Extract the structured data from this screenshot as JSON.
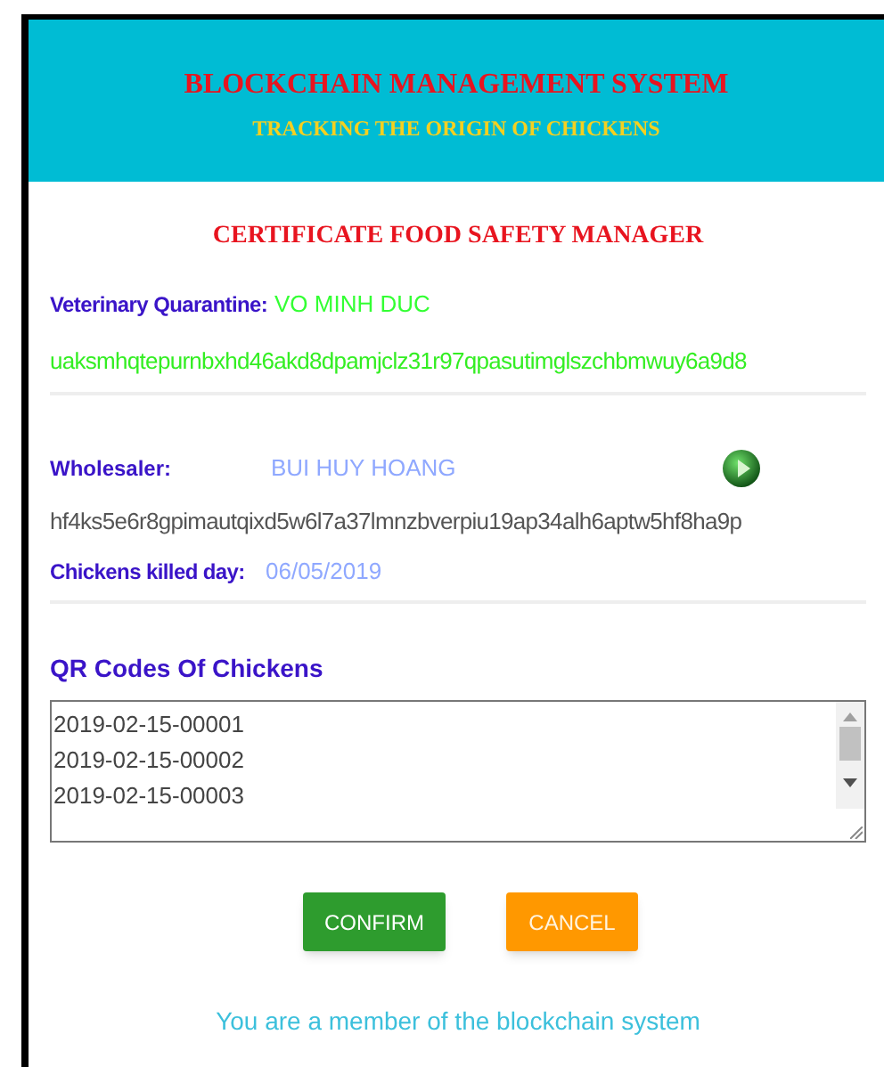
{
  "header": {
    "title": "BLOCKCHAIN MANAGEMENT SYSTEM",
    "subtitle": "TRACKING THE ORIGIN OF CHICKENS"
  },
  "form_title": "CERTIFICATE FOOD SAFETY MANAGER",
  "veterinary": {
    "label": "Veterinary Quarantine:",
    "name": "VO MINH DUC",
    "hash": "uaksmhqtepurnbxhd46akd8dpamjclz31r97qpasutimglszchbmwuy6a9d8"
  },
  "wholesaler": {
    "label": "Wholesaler:",
    "name": "BUI HUY HOANG",
    "hash": "hf4ks5e6r8gpimautqixd5w6l7a37lmnzbverpiu19ap34alh6aptw5hf8ha9p",
    "killed_label": "Chickens killed day:",
    "killed_date": "06/05/2019"
  },
  "qr": {
    "label": "QR Codes Of Chickens",
    "codes": [
      "2019-02-15-00001",
      "2019-02-15-00002",
      "2019-02-15-00003"
    ]
  },
  "buttons": [
    {
      "label": "CONFIRM",
      "kind": "confirm"
    },
    {
      "label": "CANCEL",
      "kind": "cancel"
    }
  ],
  "footer": "You are a member of the blockchain system"
}
